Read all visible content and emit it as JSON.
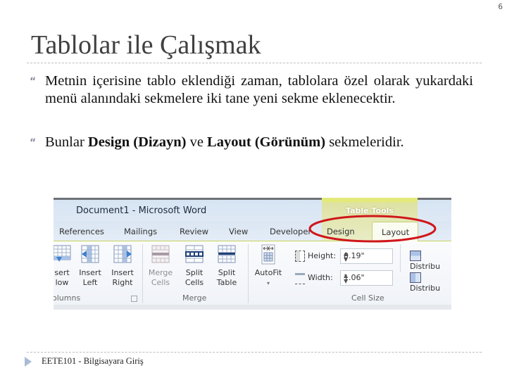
{
  "slide": {
    "page_number": "6",
    "title": "Tablolar ile Çalışmak",
    "bullet_glyph": "“",
    "bullets": [
      {
        "text": "Metnin içerisine tablo eklendiği zaman, tablolara özel olarak yukardaki menü alanındaki sekmelere iki tane yeni sekme eklenecektir."
      },
      {
        "prefix": "Bunlar ",
        "bold1": "Design (Dizayn)",
        "middle": " ve ",
        "bold2": "Layout (Görünüm)",
        "suffix": " sekmeleridir."
      }
    ],
    "footer": "EETE101 - Bilgisayara Giriş"
  },
  "word": {
    "window_title": "Document1 - Microsoft Word",
    "tabs": [
      "References",
      "Mailings",
      "Review",
      "View",
      "Developer"
    ],
    "contextual_group": "Table Tools",
    "contextual_tabs": [
      "Design",
      "Layout"
    ],
    "active_tab": "Layout",
    "highlight_color": "#d0161b",
    "buttons": [
      {
        "label1": "sert",
        "label2": "low",
        "icon": "insert-below-icon"
      },
      {
        "label1": "Insert",
        "label2": "Left",
        "icon": "insert-left-icon"
      },
      {
        "label1": "Insert",
        "label2": "Right",
        "icon": "insert-right-icon"
      },
      {
        "label1": "Merge",
        "label2": "Cells",
        "icon": "merge-cells-icon",
        "disabled": true
      },
      {
        "label1": "Split",
        "label2": "Cells",
        "icon": "split-cells-icon"
      },
      {
        "label1": "Split",
        "label2": "Table",
        "icon": "split-table-icon"
      },
      {
        "label1": "AutoFit",
        "label2": "▾",
        "icon": "autofit-icon"
      }
    ],
    "groups": [
      "olumns",
      "Merge",
      "Cell Size"
    ],
    "cell_size": {
      "height_label": "Height:",
      "height_value": "0.19\"",
      "width_label": "Width:",
      "width_value": "1.06\""
    },
    "distribute_rows": "Distribu",
    "distribute_cols": "Distribu"
  }
}
